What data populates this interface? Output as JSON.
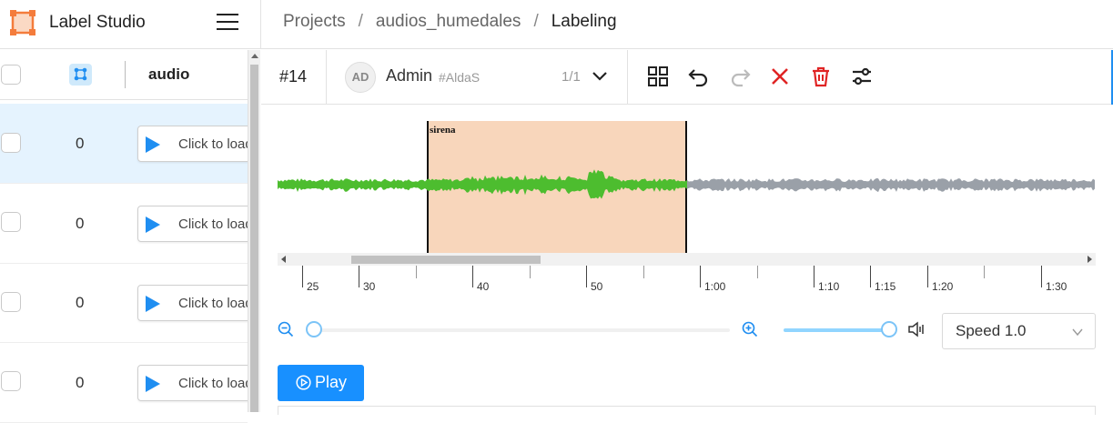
{
  "app": {
    "title": "Label Studio",
    "accent": "#1f8ef1",
    "logo_color": "#f47c3c"
  },
  "breadcrumb": {
    "items": [
      "Projects",
      "audios_humedales",
      "Labeling"
    ],
    "separator": "/"
  },
  "task_list": {
    "column_header": "audio",
    "rows": [
      {
        "value": "0",
        "audio_button": "Click to load",
        "selected": true
      },
      {
        "value": "0",
        "audio_button": "Click to load",
        "selected": false
      },
      {
        "value": "0",
        "audio_button": "Click to load",
        "selected": false
      },
      {
        "value": "0",
        "audio_button": "Click to load",
        "selected": false
      }
    ]
  },
  "annotation": {
    "task_id": "#14",
    "user_initials": "AD",
    "user_name": "Admin",
    "user_handle": "#AldaS",
    "count": "1/1",
    "toolbar_icons": [
      "grid-icon",
      "undo-icon",
      "redo-icon",
      "reject-icon",
      "delete-icon",
      "settings-icon"
    ]
  },
  "waveform": {
    "region_label": "sirena",
    "region_color": "#f4c096",
    "played_color": "#4dbd2f",
    "unplayed_color": "#9aa0a8",
    "timeline_labels": [
      "25",
      "30",
      "40",
      "50",
      "1:00",
      "1:10",
      "1:15",
      "1:20",
      "1:30"
    ]
  },
  "controls": {
    "zoom_level": 0,
    "volume_level": 1.0,
    "speed_label": "Speed 1.0",
    "play_label": "Play"
  }
}
